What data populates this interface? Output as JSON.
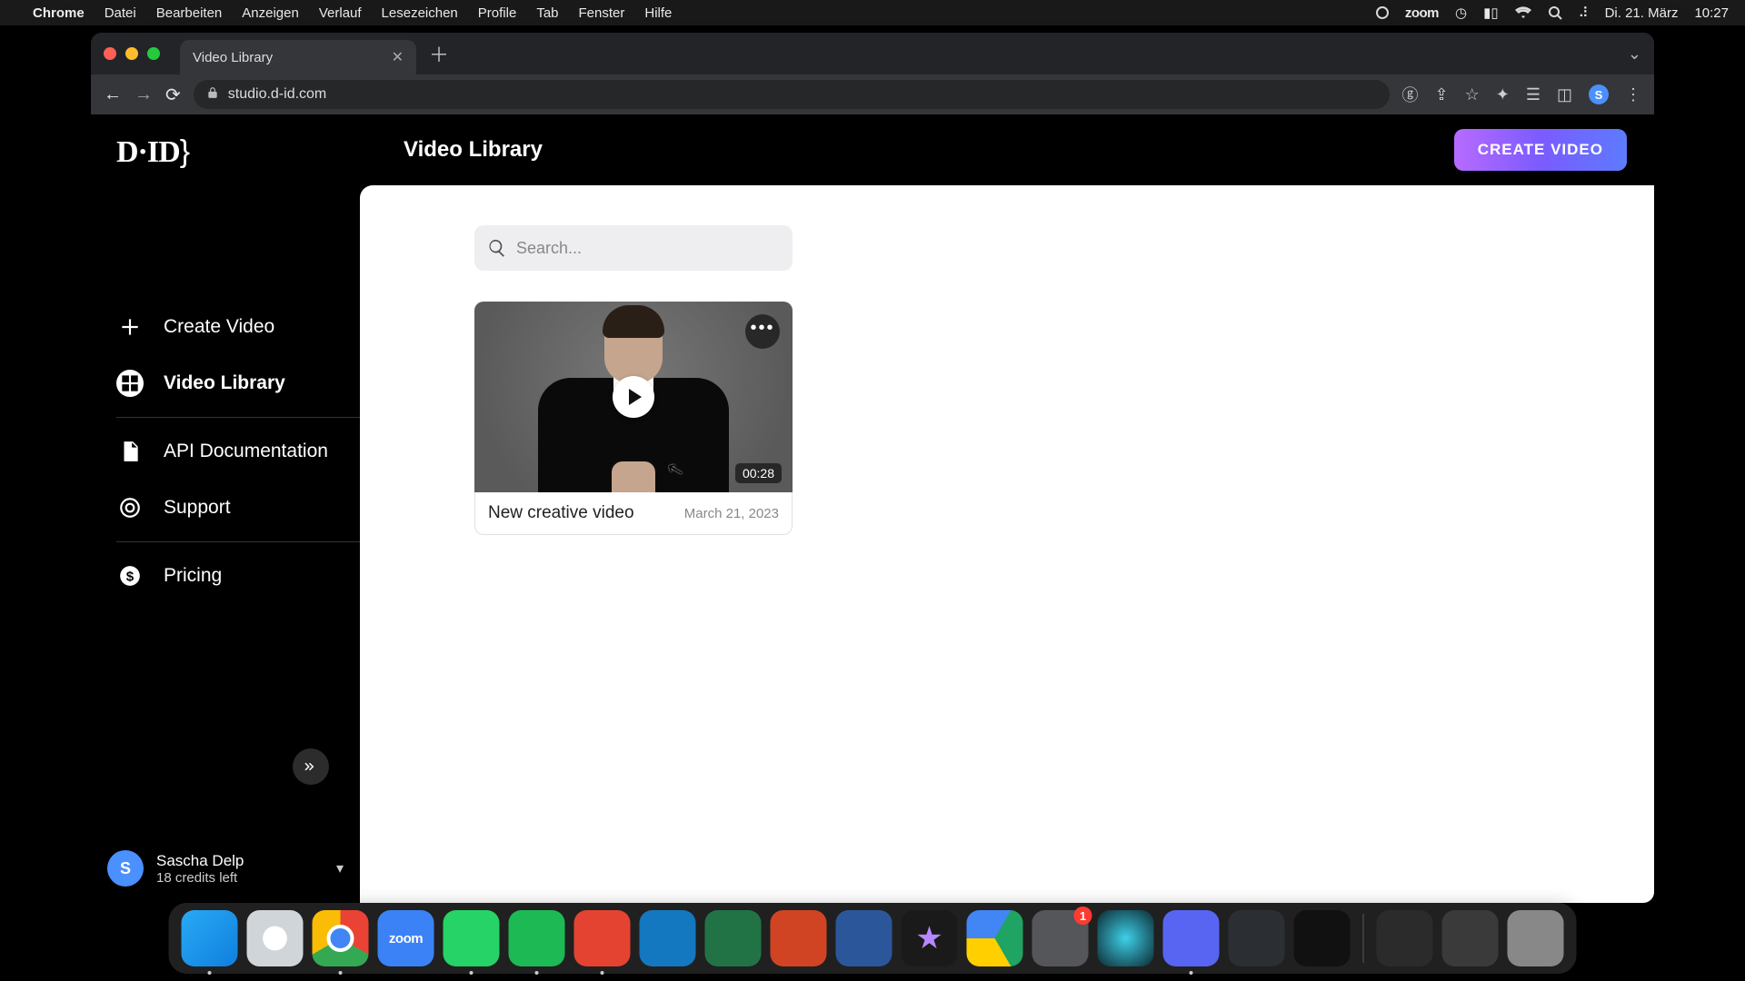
{
  "menubar": {
    "app": "Chrome",
    "items": [
      "Datei",
      "Bearbeiten",
      "Anzeigen",
      "Verlauf",
      "Lesezeichen",
      "Profile",
      "Tab",
      "Fenster",
      "Hilfe"
    ],
    "zoom": "zoom",
    "date": "Di. 21. März",
    "time": "10:27"
  },
  "browser": {
    "tab_title": "Video Library",
    "url": "studio.d-id.com",
    "profile_letter": "S"
  },
  "app": {
    "logo": "D·ID",
    "page_title": "Video Library",
    "create_button": "CREATE VIDEO",
    "sidebar": {
      "items": [
        {
          "icon": "plus",
          "label": "Create Video",
          "active": false
        },
        {
          "icon": "grid",
          "label": "Video Library",
          "active": true
        },
        {
          "icon": "doc",
          "label": "API Documentation",
          "active": false
        },
        {
          "icon": "life",
          "label": "Support",
          "active": false
        },
        {
          "icon": "dollar",
          "label": "Pricing",
          "active": false
        }
      ],
      "divider_after": [
        1,
        3
      ]
    },
    "user": {
      "initial": "S",
      "name": "Sascha Delp",
      "credits": "18 credits left"
    },
    "search": {
      "placeholder": "Search..."
    },
    "videos": [
      {
        "title": "New creative video",
        "date": "March 21, 2023",
        "duration": "00:28"
      }
    ]
  },
  "dock": {
    "badge_settings": "1",
    "zoom_label": "zoom"
  }
}
